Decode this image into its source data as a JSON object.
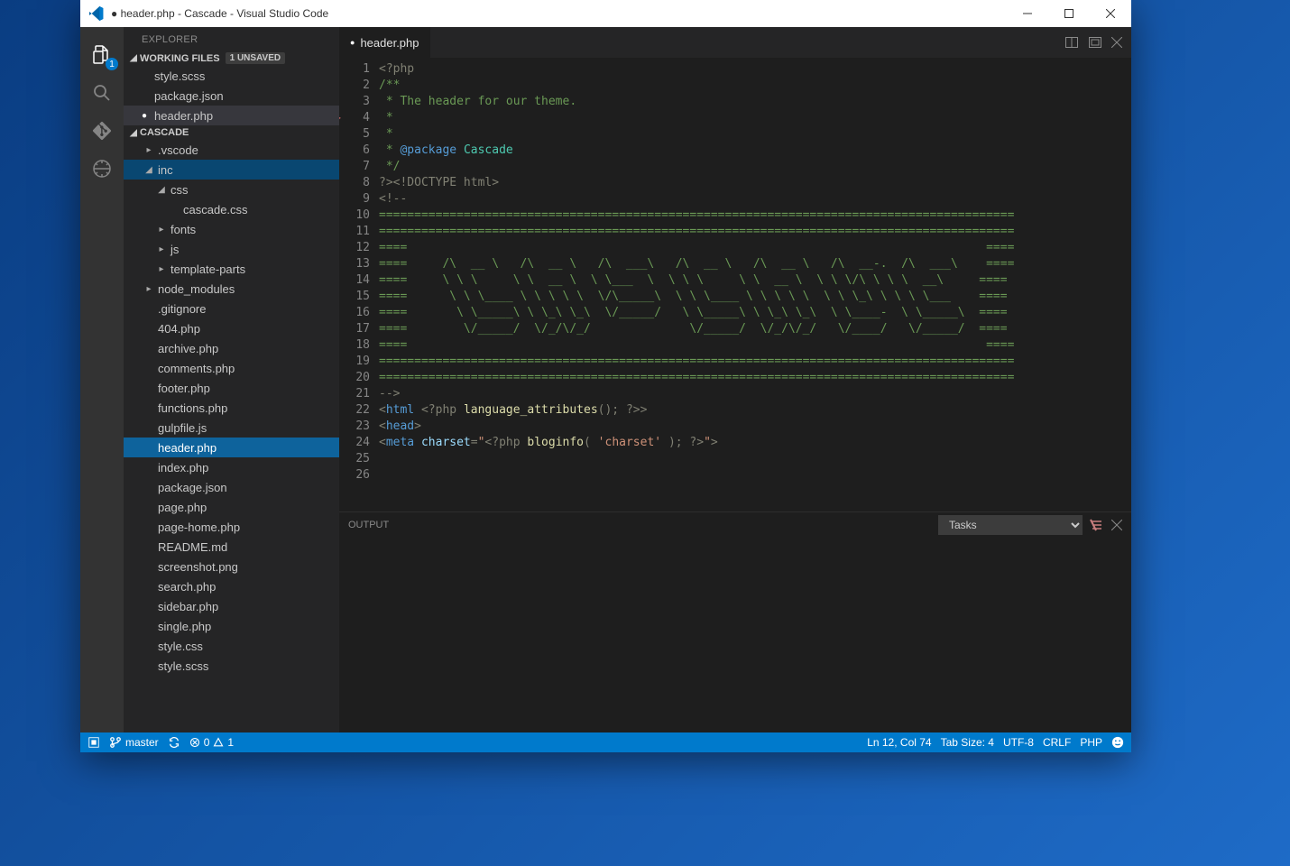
{
  "titlebar": {
    "title": "● header.php - Cascade - Visual Studio Code"
  },
  "activity": {
    "badge_files": "1"
  },
  "sidebar": {
    "title": "EXPLORER",
    "working_files": {
      "label": "WORKING FILES",
      "badge": "1 UNSAVED",
      "items": [
        {
          "label": "style.scss"
        },
        {
          "label": "package.json"
        },
        {
          "label": "header.php",
          "dirty": true,
          "active": true
        }
      ]
    },
    "project": {
      "label": "CASCADE",
      "tree": [
        {
          "label": ".vscode",
          "kind": "folder",
          "depth": 1,
          "expanded": false
        },
        {
          "label": "inc",
          "kind": "folder",
          "depth": 1,
          "expanded": true,
          "selected": "folder"
        },
        {
          "label": "css",
          "kind": "folder",
          "depth": 2,
          "expanded": true
        },
        {
          "label": "cascade.css",
          "kind": "file",
          "depth": 3
        },
        {
          "label": "fonts",
          "kind": "folder",
          "depth": 2,
          "expanded": false
        },
        {
          "label": "js",
          "kind": "folder",
          "depth": 2,
          "expanded": false
        },
        {
          "label": "template-parts",
          "kind": "folder",
          "depth": 2,
          "expanded": false
        },
        {
          "label": "node_modules",
          "kind": "folder",
          "depth": 1,
          "expanded": false
        },
        {
          "label": ".gitignore",
          "kind": "file",
          "depth": 1
        },
        {
          "label": "404.php",
          "kind": "file",
          "depth": 1
        },
        {
          "label": "archive.php",
          "kind": "file",
          "depth": 1
        },
        {
          "label": "comments.php",
          "kind": "file",
          "depth": 1
        },
        {
          "label": "footer.php",
          "kind": "file",
          "depth": 1
        },
        {
          "label": "functions.php",
          "kind": "file",
          "depth": 1
        },
        {
          "label": "gulpfile.js",
          "kind": "file",
          "depth": 1
        },
        {
          "label": "header.php",
          "kind": "file",
          "depth": 1,
          "selected": "blue"
        },
        {
          "label": "index.php",
          "kind": "file",
          "depth": 1
        },
        {
          "label": "package.json",
          "kind": "file",
          "depth": 1
        },
        {
          "label": "page.php",
          "kind": "file",
          "depth": 1
        },
        {
          "label": "page-home.php",
          "kind": "file",
          "depth": 1
        },
        {
          "label": "README.md",
          "kind": "file",
          "depth": 1
        },
        {
          "label": "screenshot.png",
          "kind": "file",
          "depth": 1
        },
        {
          "label": "search.php",
          "kind": "file",
          "depth": 1
        },
        {
          "label": "sidebar.php",
          "kind": "file",
          "depth": 1
        },
        {
          "label": "single.php",
          "kind": "file",
          "depth": 1
        },
        {
          "label": "style.css",
          "kind": "file",
          "depth": 1
        },
        {
          "label": "style.scss",
          "kind": "file",
          "depth": 1
        }
      ]
    }
  },
  "editor": {
    "tab_label": "header.php",
    "lines": [
      {
        "n": 1,
        "t": [
          [
            "delim",
            "<?php"
          ]
        ]
      },
      {
        "n": 2,
        "t": [
          [
            "com",
            "/**"
          ]
        ]
      },
      {
        "n": 3,
        "t": [
          [
            "com",
            " * The header for our theme."
          ]
        ]
      },
      {
        "n": 4,
        "t": [
          [
            "com",
            " *"
          ]
        ],
        "glyph": true
      },
      {
        "n": 5,
        "t": [
          [
            "com",
            " *"
          ]
        ]
      },
      {
        "n": 6,
        "t": [
          [
            "com",
            " * "
          ],
          [
            "ann",
            "@package"
          ],
          [
            "com",
            " "
          ],
          [
            "name",
            "Cascade"
          ]
        ]
      },
      {
        "n": 7,
        "t": [
          [
            "com",
            " */"
          ]
        ]
      },
      {
        "n": 8,
        "t": [
          [
            "",
            ""
          ]
        ]
      },
      {
        "n": 9,
        "t": [
          [
            "delim",
            "?>"
          ],
          [
            "ctag",
            "<!DOCTYPE html>"
          ]
        ]
      },
      {
        "n": 10,
        "t": [
          [
            "ctag",
            "<!--"
          ]
        ]
      },
      {
        "n": 11,
        "t": [
          [
            "com",
            "=========================================================================================="
          ]
        ]
      },
      {
        "n": 12,
        "t": [
          [
            "com",
            "=========================================================================================="
          ]
        ]
      },
      {
        "n": 13,
        "t": [
          [
            "com",
            "====                                                                                  ===="
          ]
        ]
      },
      {
        "n": 14,
        "t": [
          [
            "com",
            "====     /\\  __ \\   /\\  __ \\   /\\  ___\\   /\\  __ \\   /\\  __ \\   /\\  __-.  /\\  ___\\    ===="
          ]
        ]
      },
      {
        "n": 15,
        "t": [
          [
            "com",
            "====     \\ \\ \\     \\ \\  __ \\  \\ \\___  \\  \\ \\ \\     \\ \\  __ \\  \\ \\ \\/\\ \\ \\ \\  __\\     ===="
          ]
        ]
      },
      {
        "n": 16,
        "t": [
          [
            "com",
            "====      \\ \\ \\____ \\ \\ \\ \\ \\  \\/\\_____\\  \\ \\ \\____ \\ \\ \\ \\ \\  \\ \\ \\_\\ \\ \\ \\ \\___    ===="
          ]
        ]
      },
      {
        "n": 17,
        "t": [
          [
            "com",
            "====       \\ \\_____\\ \\ \\_\\ \\_\\  \\/_____/   \\ \\_____\\ \\ \\_\\ \\_\\  \\ \\____-  \\ \\_____\\  ===="
          ]
        ]
      },
      {
        "n": 18,
        "t": [
          [
            "com",
            "====        \\/_____/  \\/_/\\/_/              \\/_____/  \\/_/\\/_/   \\/____/   \\/_____/  ===="
          ]
        ]
      },
      {
        "n": 19,
        "t": [
          [
            "com",
            "====                                                                                  ===="
          ]
        ]
      },
      {
        "n": 20,
        "t": [
          [
            "com",
            "=========================================================================================="
          ]
        ]
      },
      {
        "n": 21,
        "t": [
          [
            "com",
            "=========================================================================================="
          ]
        ]
      },
      {
        "n": 22,
        "t": [
          [
            "ctag",
            "-->"
          ]
        ]
      },
      {
        "n": 23,
        "t": [
          [
            "",
            ""
          ]
        ]
      },
      {
        "n": 24,
        "t": [
          [
            "ctag",
            "<"
          ],
          [
            "tag",
            "html"
          ],
          [
            "",
            ""
          ],
          [
            "delim",
            " <?php "
          ],
          [
            "func",
            "language_attributes"
          ],
          [
            "delim",
            "(); ?>"
          ],
          [
            "ctag",
            ">"
          ]
        ]
      },
      {
        "n": 25,
        "t": [
          [
            "ctag",
            "<"
          ],
          [
            "tag",
            "head"
          ],
          [
            "ctag",
            ">"
          ]
        ]
      },
      {
        "n": 26,
        "t": [
          [
            "ctag",
            "<"
          ],
          [
            "tag",
            "meta"
          ],
          [
            "",
            " "
          ],
          [
            "attr",
            "charset"
          ],
          [
            "ctag",
            "="
          ],
          [
            "str",
            "\""
          ],
          [
            "delim",
            "<?php "
          ],
          [
            "func",
            "bloginfo"
          ],
          [
            "delim",
            "( "
          ],
          [
            "str",
            "'charset'"
          ],
          [
            "delim",
            " ); ?>"
          ],
          [
            "str",
            "\""
          ],
          [
            "ctag",
            ">"
          ]
        ]
      }
    ]
  },
  "panel": {
    "title": "OUTPUT",
    "dropdown": "Tasks"
  },
  "status": {
    "branch": "master",
    "errors": "0",
    "warnings": "1",
    "cursor": "Ln 12, Col 74",
    "tabsize": "Tab Size: 4",
    "encoding": "UTF-8",
    "eol": "CRLF",
    "lang": "PHP"
  }
}
